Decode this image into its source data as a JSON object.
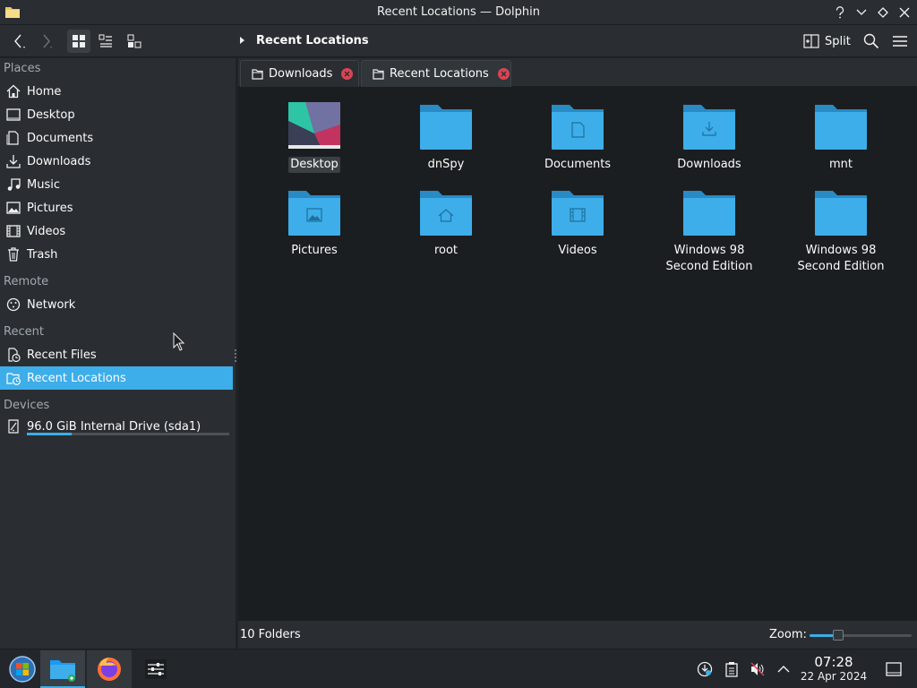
{
  "window": {
    "title": "Recent Locations — Dolphin"
  },
  "toolbar": {
    "breadcrumb": "Recent Locations",
    "split_label": "Split"
  },
  "sidebar": {
    "sections": {
      "places": "Places",
      "remote": "Remote",
      "recent": "Recent",
      "devices": "Devices"
    },
    "places": [
      {
        "label": "Home",
        "icon": "home-icon"
      },
      {
        "label": "Desktop",
        "icon": "desktop-icon"
      },
      {
        "label": "Documents",
        "icon": "documents-icon"
      },
      {
        "label": "Downloads",
        "icon": "downloads-icon"
      },
      {
        "label": "Music",
        "icon": "music-icon"
      },
      {
        "label": "Pictures",
        "icon": "pictures-icon"
      },
      {
        "label": "Videos",
        "icon": "videos-icon"
      },
      {
        "label": "Trash",
        "icon": "trash-icon"
      }
    ],
    "remote": [
      {
        "label": "Network",
        "icon": "network-icon"
      }
    ],
    "recent": [
      {
        "label": "Recent Files",
        "icon": "recent-files-icon"
      },
      {
        "label": "Recent Locations",
        "icon": "recent-locations-icon",
        "selected": true
      }
    ],
    "devices": [
      {
        "label": "96.0 GiB Internal Drive (sda1)",
        "icon": "drive-icon",
        "usage_fraction": 0.22
      }
    ]
  },
  "tabs": [
    {
      "label": "Downloads",
      "active": false
    },
    {
      "label": "Recent Locations",
      "active": true
    }
  ],
  "items": [
    {
      "name": "Desktop",
      "kind": "wallpaper-thumbnail"
    },
    {
      "name": "dnSpy",
      "kind": "folder"
    },
    {
      "name": "Documents",
      "kind": "folder-documents"
    },
    {
      "name": "Downloads",
      "kind": "folder-downloads"
    },
    {
      "name": "mnt",
      "kind": "folder"
    },
    {
      "name": "Pictures",
      "kind": "folder-pictures"
    },
    {
      "name": "root",
      "kind": "folder-home"
    },
    {
      "name": "Videos",
      "kind": "folder-videos"
    },
    {
      "name": "Windows 98 Second Edition",
      "kind": "folder"
    },
    {
      "name": "Windows 98 Second Edition",
      "kind": "folder"
    }
  ],
  "status": {
    "summary": "10 Folders",
    "zoom_label": "Zoom:",
    "zoom_fraction": 0.28
  },
  "taskbar": {
    "apps": [
      "start-menu-icon",
      "dolphin-icon",
      "firefox-icon",
      "settings-icon"
    ],
    "clock": {
      "time": "07:28",
      "date": "22 Apr 2024"
    }
  },
  "colors": {
    "accent": "#3daee9",
    "folder": "#3daee9",
    "close": "#da4453"
  }
}
